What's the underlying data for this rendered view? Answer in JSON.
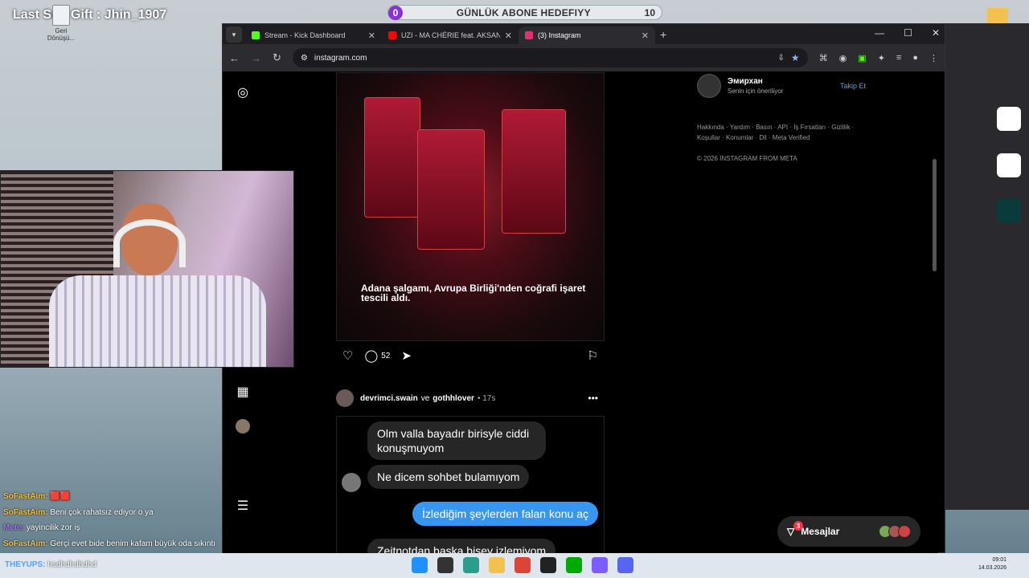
{
  "overlay": {
    "last_gift": "Last Sub Gift : Jhin_1907",
    "desktop_icon_label": "Geri Dönüşü...",
    "goal_current": "0",
    "goal_title": "GÜNLÜK ABONE HEDEFIYY",
    "goal_target": "10"
  },
  "browser": {
    "tabs": [
      {
        "label": "Stream - Kick Dashboard",
        "fav_color": "#53fc18"
      },
      {
        "label": "UZI - MA CHÉRIE feat. AKSAN (Ly...",
        "fav_color": "#ff0000"
      },
      {
        "label": "(3) Instagram",
        "fav_color": "#e1306c"
      }
    ],
    "url": "instagram.com"
  },
  "post1": {
    "caption_overlay": "Adana şalgamı, Avrupa Birliği'nden coğrafi işaret tescili aldı.",
    "comment_count": "52"
  },
  "post2": {
    "users": "devrimci.swain",
    "and": "ve",
    "user2": "gothhlover",
    "time": "• 17s",
    "messages": [
      {
        "dir": "in",
        "text": "Olm valla bayadır birisyle ciddi konuşmuyom"
      },
      {
        "dir": "in",
        "text": "Ne dicem sohbet bulamıyom"
      },
      {
        "dir": "out",
        "text": "İzlediğim şeylerden falan konu aç"
      },
      {
        "dir": "in",
        "text": "Zeitnotdan baska bisey izlemiyom"
      }
    ]
  },
  "right": {
    "suggest_name": "Эмирхан",
    "suggest_sub": "Senin için öneriliyor",
    "follow": "Takip Et",
    "footer1": "Hakkında · Yardım · Basın · API · İş Fırsatları · Gizlilik ·",
    "footer2": "Koşullar · Konumlar · Dil · Meta Verified",
    "copyright": "© 2026 INSTAGRAM FROM META",
    "messages_label": "Mesajlar",
    "messages_badge": "3"
  },
  "stream_chat": [
    {
      "user": "SoFastAim:",
      "msg": "🟥🟥",
      "color": "#f0c040"
    },
    {
      "user": "SoFastAim:",
      "msg": "Beni çok rahatsız ediyor o ya",
      "color": "#f0c040"
    },
    {
      "user": "Mete:",
      "msg": "yayincilik zor iş",
      "color": "#a070ff"
    },
    {
      "user": "SoFastAim:",
      "msg": "Gerçi evet bide benim kafam büyük oda sıkıntı",
      "color": "#f0c040"
    },
    {
      "user": "THEYUPS:",
      "msg": "hsdhdhdhdhd",
      "color": "#4aa3ff"
    }
  ],
  "taskbar": {
    "time": "09:01",
    "date": "14.03.2026"
  }
}
